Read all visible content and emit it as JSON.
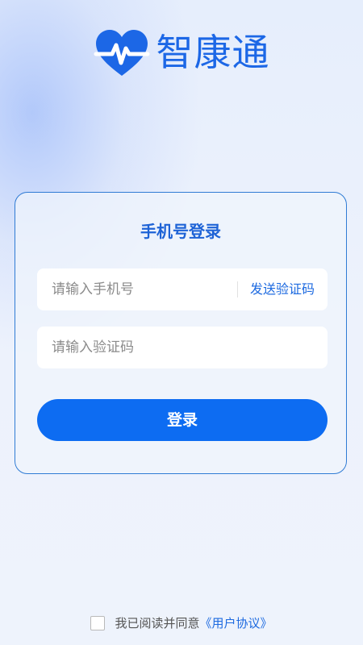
{
  "app": {
    "brand_name": "智康通",
    "brand_color": "#1c67e6",
    "logo_icon": "heart-pulse-icon"
  },
  "login_card": {
    "title": "手机号登录",
    "phone_placeholder": "请输入手机号",
    "send_code_label": "发送验证码",
    "code_placeholder": "请输入验证码",
    "login_button_label": "登录",
    "button_color": "#0d6cf2"
  },
  "agreement": {
    "checked": false,
    "text": "我已阅读并同意",
    "link_text": "《用户协议》"
  }
}
